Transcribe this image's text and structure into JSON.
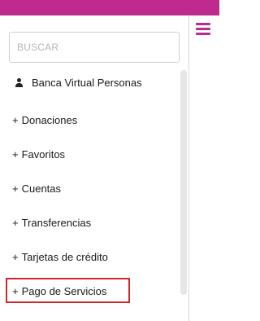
{
  "colors": {
    "brand": "#bf2a8e",
    "highlight": "#d3272e"
  },
  "header": {
    "menu_icon": "hamburger-menu-icon"
  },
  "search": {
    "placeholder": "BUSCAR"
  },
  "user": {
    "icon": "user-icon",
    "label": "Banca Virtual Personas"
  },
  "nav": {
    "items": [
      {
        "prefix": "+",
        "label": "Donaciones"
      },
      {
        "prefix": "+",
        "label": "Favoritos"
      },
      {
        "prefix": "+",
        "label": "Cuentas"
      },
      {
        "prefix": "+",
        "label": "Transferencias"
      },
      {
        "prefix": "+",
        "label": "Tarjetas de crédito"
      },
      {
        "prefix": "+",
        "label": "Pago de Servicios",
        "highlighted": true
      }
    ]
  }
}
